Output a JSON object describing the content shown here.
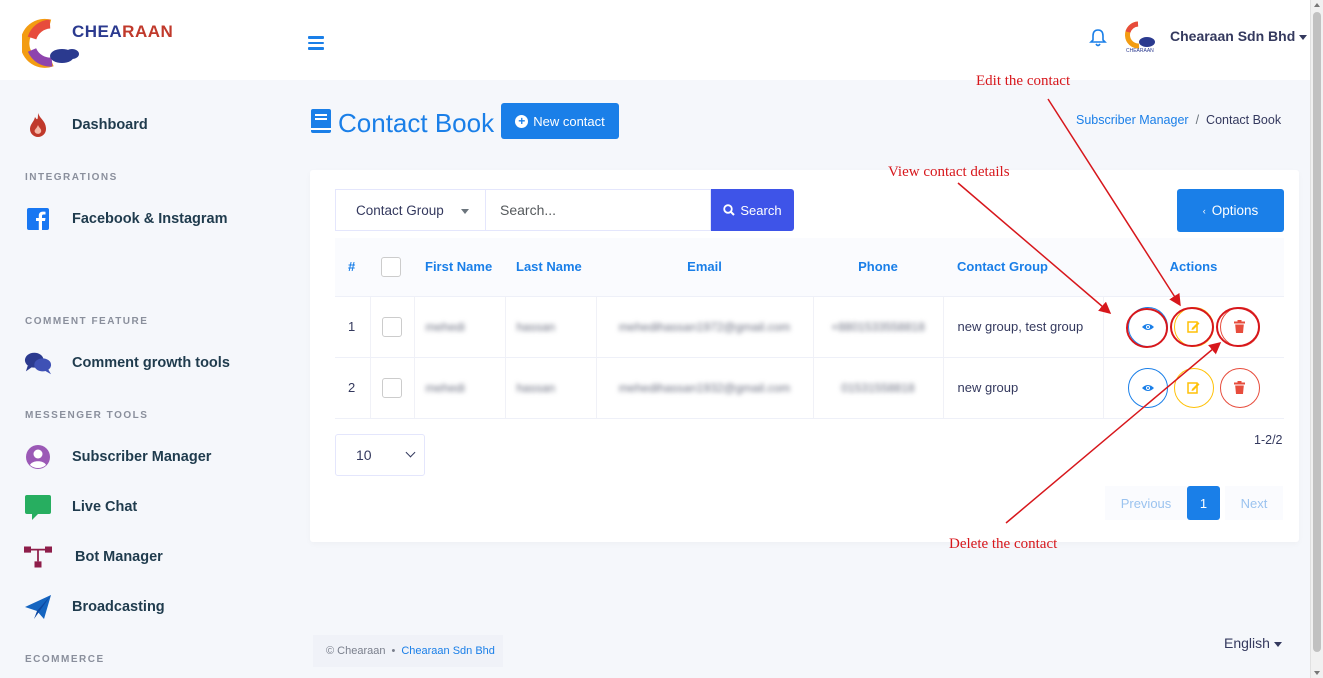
{
  "brand": {
    "name_part1": "CHEA",
    "name_part2": "RAAN",
    "logo_colors": [
      "#f39c12",
      "#e74c3c",
      "#8e44ad",
      "#2b3a8f"
    ]
  },
  "header": {
    "company": "Chearaan Sdn Bhd"
  },
  "sidebar": {
    "items": [
      {
        "label": "Dashboard",
        "icon": "flame-icon"
      },
      {
        "section": "INTEGRATIONS"
      },
      {
        "label": "Facebook & Instagram",
        "icon": "facebook-icon"
      },
      {
        "section": "COMMENT FEATURE"
      },
      {
        "label": "Comment growth tools",
        "icon": "chat-bubbles-icon"
      },
      {
        "section": "MESSENGER TOOLS"
      },
      {
        "label": "Subscriber Manager",
        "icon": "user-circle-icon"
      },
      {
        "label": "Live Chat",
        "icon": "chat-icon"
      },
      {
        "label": "Bot Manager",
        "icon": "sitemap-icon"
      },
      {
        "label": "Broadcasting",
        "icon": "paper-plane-icon"
      },
      {
        "section": "ECOMMERCE"
      }
    ]
  },
  "page": {
    "title": "Contact Book",
    "new_button": "New contact",
    "breadcrumb": {
      "parent": "Subscriber Manager",
      "separator": "/",
      "current": "Contact Book"
    }
  },
  "toolbar": {
    "group_select": "Contact Group",
    "search_placeholder": "Search...",
    "search_button": "Search",
    "options_button": "Options"
  },
  "table": {
    "headers": [
      "#",
      "",
      "First Name",
      "Last Name",
      "Email",
      "Phone",
      "Contact Group",
      "Actions"
    ],
    "rows": [
      {
        "num": "1",
        "first": "mehedi",
        "last": "hassan",
        "email": "mehedihassan1972@gmail.com",
        "phone": "+8801533558818",
        "group": "new group, test group"
      },
      {
        "num": "2",
        "first": "mehedi",
        "last": "hassan",
        "email": "mehedihassan1932@gmail.com",
        "phone": "01531558818",
        "group": "new group"
      }
    ]
  },
  "pagination": {
    "per_page": "10",
    "info": "1-2/2",
    "previous": "Previous",
    "current": "1",
    "next": "Next"
  },
  "footer": {
    "copyright": "© Chearaan",
    "bullet": "•",
    "company_link": "Chearaan Sdn Bhd"
  },
  "language": "English",
  "annotations": {
    "edit": "Edit the contact",
    "view": "View contact details",
    "delete": "Delete the contact"
  },
  "colors": {
    "primary": "#1a7fe8",
    "search": "#3e54e8",
    "edit": "#ffc107",
    "delete": "#e74c3c",
    "annotation": "#d7171c"
  }
}
